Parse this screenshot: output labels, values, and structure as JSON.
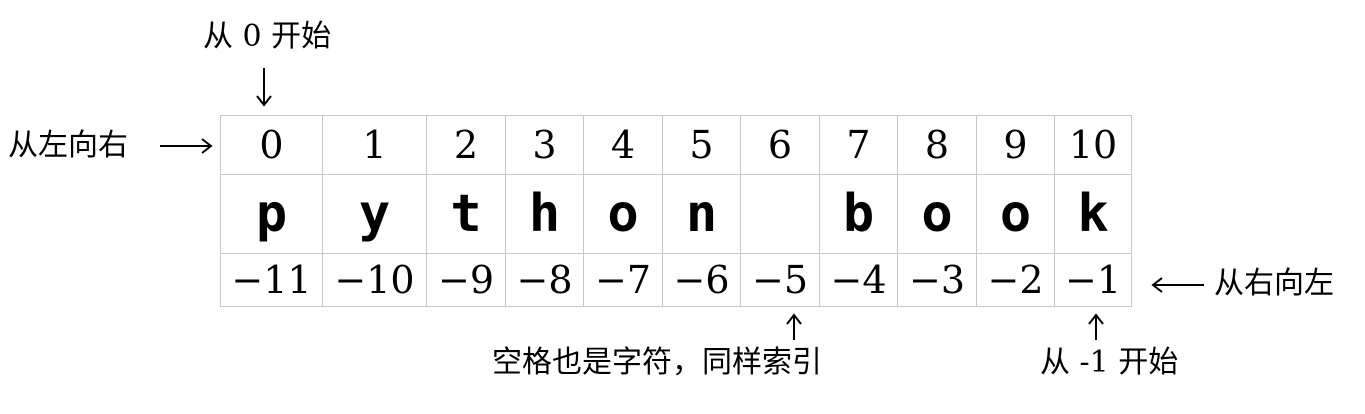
{
  "annotations": {
    "top_start": "从 0 开始",
    "left_to_right": "从左向右",
    "right_to_left": "从右向左",
    "space_note": "空格也是字符，同样索引",
    "neg_start": "从 -1 开始"
  },
  "grid": {
    "positive_indices": [
      "0",
      "1",
      "2",
      "3",
      "4",
      "5",
      "6",
      "7",
      "8",
      "9",
      "10"
    ],
    "characters": [
      "p",
      "y",
      "t",
      "h",
      "o",
      "n",
      " ",
      "b",
      "o",
      "o",
      "k"
    ],
    "negative_indices": [
      "−11",
      "−10",
      "−9",
      "−8",
      "−7",
      "−6",
      "−5",
      "−4",
      "−3",
      "−2",
      "−1"
    ]
  },
  "icons": {
    "down_arrow": "arrow-down-icon",
    "right_arrow": "arrow-right-icon",
    "left_arrow": "arrow-left-icon",
    "up_arrow": "arrow-up-icon"
  }
}
